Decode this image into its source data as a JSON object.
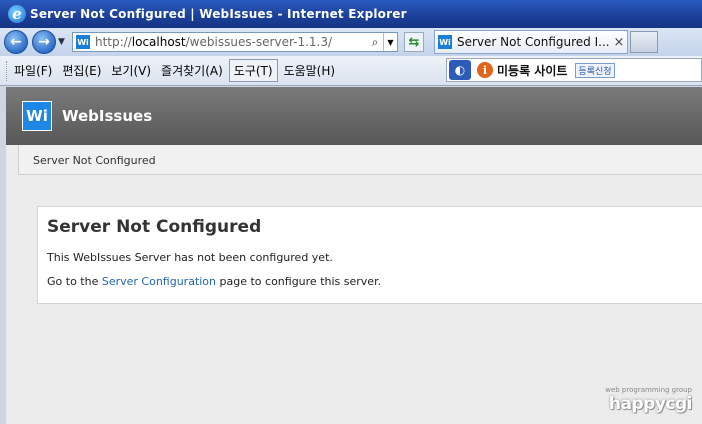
{
  "window": {
    "title": "Server Not Configured | WebIssues - Internet Explorer",
    "ie_logo": "e"
  },
  "nav": {
    "address": "http://localhost/webissues-server-1.1.3/",
    "address_prefix": "http://",
    "address_host": "localhost",
    "address_path": "/webissues-server-1.1.3/",
    "favicon": "Wi",
    "tab_label": "Server Not Configured I...",
    "tab_close": "×"
  },
  "menu": {
    "items": [
      "파일(F)",
      "편집(E)",
      "보기(V)",
      "즐겨찾기(A)",
      "도구(T)",
      "도움말(H)"
    ],
    "active_index": 4
  },
  "linkbar": {
    "info_glyph": "i",
    "text": "미등록 사이트",
    "button": "등록신청"
  },
  "site": {
    "logo": "Wi",
    "title": "WebIssues",
    "breadcrumb": "Server Not Configured"
  },
  "panel": {
    "title": "Server Not Configured",
    "text1": "This WebIssues Server has not been configured yet.",
    "text2_before": "Go to the ",
    "text2_link": "Server Configuration",
    "text2_after": " page to configure this server."
  },
  "watermark": {
    "small": "web programming group",
    "big": "happycgi"
  },
  "colors": {
    "titlebar": "#1b3f98",
    "header": "#5c5c5c",
    "link": "#2465b0",
    "logo": "#1e86e4"
  }
}
